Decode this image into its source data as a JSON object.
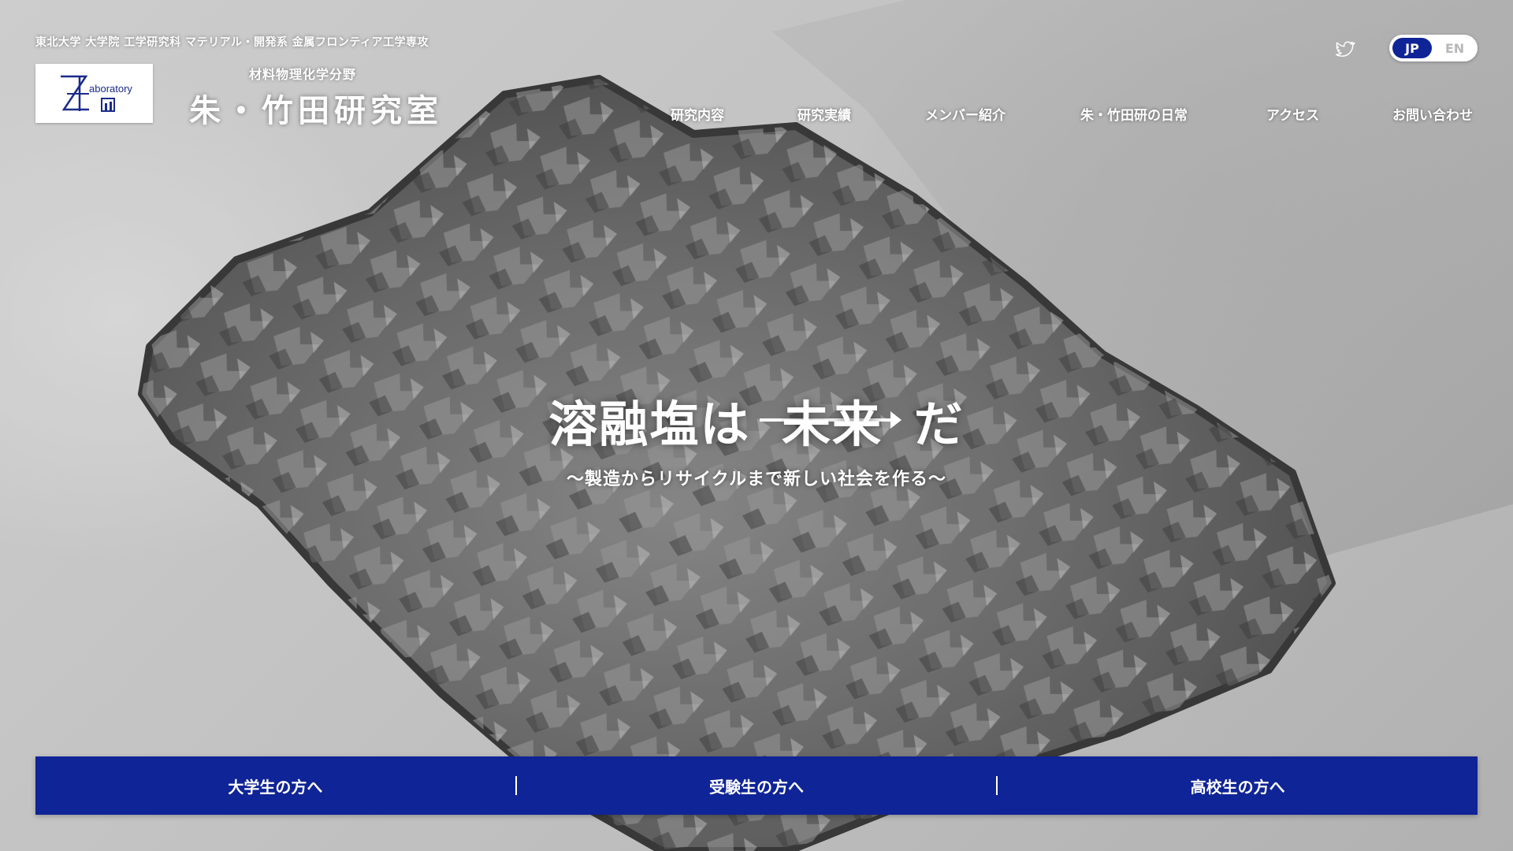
{
  "header": {
    "affiliation": "東北大学 大学院 工学研究科 マテリアル・開発系 金属フロンティア工学専攻",
    "logo_text": "aboratory",
    "lab_field": "材料物理化学分野",
    "lab_name": "朱・竹田研究室"
  },
  "social": {
    "icon": "twitter-icon"
  },
  "language": {
    "jp": "JP",
    "en": "EN",
    "selected": "JP"
  },
  "nav": {
    "items": [
      {
        "label": "研究内容"
      },
      {
        "label": "研究実績"
      },
      {
        "label": "メンバー紹介"
      },
      {
        "label": "朱・竹田研の日常"
      },
      {
        "label": "アクセス"
      },
      {
        "label": "お問い合わせ"
      }
    ]
  },
  "hero": {
    "headline_pre": "溶融塩は",
    "headline_future": "未来",
    "headline_post": "だ",
    "subline": "〜製造からリサイクルまで新しい社会を作る〜"
  },
  "audience": {
    "items": [
      {
        "label": "大学生の方へ"
      },
      {
        "label": "受験生の方へ"
      },
      {
        "label": "高校生の方へ"
      }
    ]
  },
  "colors": {
    "accent": "#0f2496",
    "text": "#ffffff"
  }
}
